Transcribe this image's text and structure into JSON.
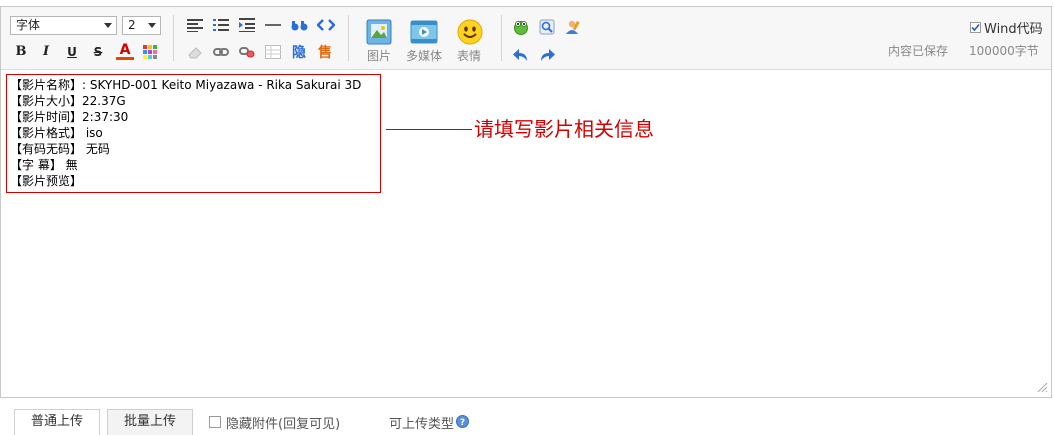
{
  "toolbar": {
    "font_select": "字体",
    "size_select": "2",
    "bold": "B",
    "italic": "I",
    "underline": "U",
    "strike": "S",
    "font_color": "A",
    "image_label": "图片",
    "media_label": "多媒体",
    "emoji_label": "表情",
    "hide_label": "隐",
    "sell_label": "售",
    "wind_code_label": "Wind代码",
    "wind_code_checked": true,
    "save_status": "内容已保存",
    "char_count": "100000字节",
    "colors": {
      "accent_red": "#d40000",
      "toolbar_bg": "#f7f7f7",
      "link_blue": "#2a6ed8"
    }
  },
  "content": {
    "lines": [
      "【影片名称】: SKYHD-001 Keito Miyazawa - Rika Sakurai 3D",
      "【影片大小】22.37G",
      "【影片时间】2:37:30",
      "【影片格式】 iso",
      "【有码无码】 无码",
      "【字  幕】 無",
      "【影片预览】"
    ],
    "annotation": "请填写影片相关信息"
  },
  "upload": {
    "tab_normal": "普通上传",
    "tab_batch": "批量上传",
    "hide_attach": "隐藏附件(回复可见)",
    "allowed_types": "可上传类型"
  }
}
